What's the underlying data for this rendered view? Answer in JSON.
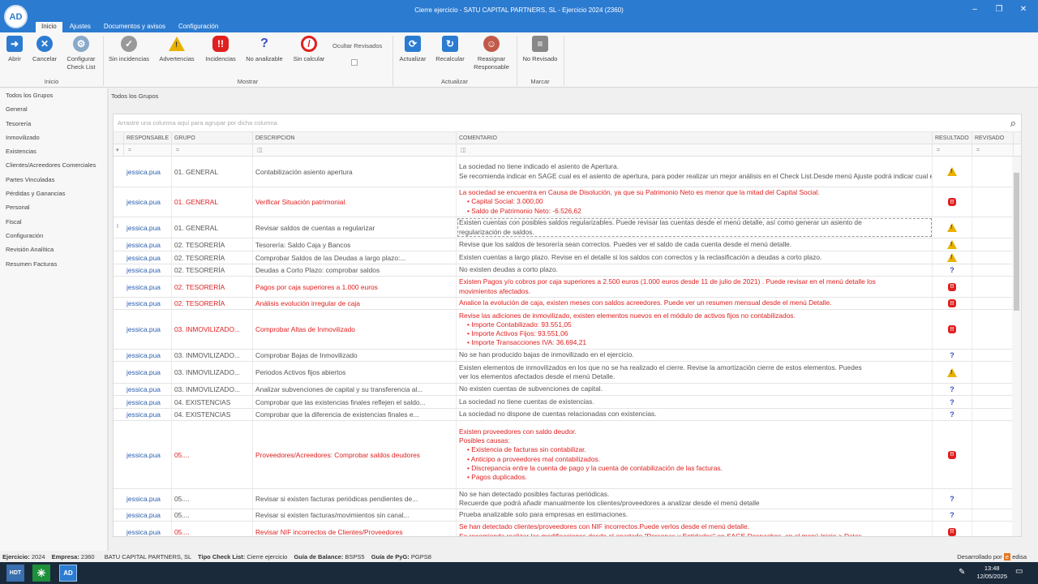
{
  "window": {
    "title": "Cierre ejercicio - SATU CAPITAL PARTNERS, SL - Ejercicio 2024 (2360)",
    "logo": "AD"
  },
  "tabs": [
    "Inicio",
    "Ajustes",
    "Documentos y avisos",
    "Configuración"
  ],
  "ribbon": {
    "abrir": "Abrir",
    "cancelar": "Cancelar",
    "configurar": "Configurar Check List",
    "sin_incidencias": "Sin incidencias",
    "advertencias": "Advertencias",
    "incidencias": "Incidencias",
    "no_analizable": "No analizable",
    "sin_calcular": "Sin calcular",
    "ocultar": "Ocultar Revisados",
    "actualizar": "Actualizar",
    "recalcular": "Recalcular",
    "reasignar": "Reasignar Responsable",
    "no_revisado": "No Revisado",
    "group_inicio": "Inicio",
    "group_mostrar": "Mostrar",
    "group_actualizar": "Actualizar",
    "group_marcar": "Marcar"
  },
  "sidebar": [
    "Todos los Grupos",
    "General",
    "Tesorería",
    "Inmovilizado",
    "Existencias",
    "Clientes/Acreedores Comerciales",
    "Partes Vinculadas",
    "Pérdidas y Ganancias",
    "Personal",
    "Fiscal",
    "Configuración",
    "Revisión Analítica",
    "Resumen Facturas"
  ],
  "breadcrumb": "Todos los Grupos",
  "grid": {
    "group_hint": "Arrastre una columna aquí para agrupar por dicha columna",
    "headers": {
      "responsable": "RESPONSABLE",
      "grupo": "GRUPO",
      "descripcion": "DESCRIPCION",
      "comentario": "COMENTARIO",
      "resultado": "RESULTADO",
      "revisado": "REVISADO"
    },
    "rows": [
      {
        "h": 38,
        "red": false,
        "resp": "jessica.pua",
        "grp": "01. GENERAL",
        "des": "Contabilización asiento apertura",
        "res": "warn",
        "com": [
          "La sociedad no tiene indicado el asiento de Apertura.",
          "Se recomienda indicar en SAGE cual es el asiento de apertura, para poder realizar un mejor análisis en el Check List.Desde menú Ajuste podrá indicar cual es el asiento de apertura."
        ]
      },
      {
        "h": 37,
        "red": true,
        "resp": "jessica.pua",
        "grp": "01. GENERAL",
        "des": "Verificar Situación patrimonial.",
        "res": "err",
        "com": [
          "La sociedad se encuentra en Causa de Disolución, ya que su Patrimonio Neto es menor que la mitad del Capital Social.",
          "• Capital Social: 3.000,00",
          "• Saldo de Patrimonio Neto: -6.526,62"
        ]
      },
      {
        "h": 26,
        "red": false,
        "sel": true,
        "ind": "I",
        "resp": "jessica.pua",
        "grp": "01. GENERAL",
        "des": "Revisar saldos de cuentas a regularizar",
        "res": "warn",
        "com": [
          "Existen cuentas con posibles saldos regularizables. Puede revisar las cuentas desde el menú detalle, así como generar un asiento de",
          "regularización de saldos."
        ]
      },
      {
        "h": 16,
        "red": false,
        "resp": "jessica.pua",
        "grp": "02. TESORERÍA",
        "des": "Tesorería: Saldo Caja y Bancos",
        "res": "warn",
        "com": [
          "Revise que los saldos de tesorería sean correctos. Puedes ver el saldo de cada cuenta desde el menú detalle."
        ]
      },
      {
        "h": 16,
        "red": false,
        "resp": "jessica.pua",
        "grp": "02. TESORERÍA",
        "des": "Comprobar Saldos de las Deudas a largo plazo:...",
        "res": "warn",
        "com": [
          "Existen cuentas a largo plazo. Revise en el detalle si los saldos con correctos y la reclasificación a deudas a corto plazo."
        ]
      },
      {
        "h": 15,
        "red": false,
        "resp": "jessica.pua",
        "grp": "02. TESORERÍA",
        "des": "Deudas a Corto Plazo: comprobar saldos",
        "res": "q",
        "com": [
          "No existen deudas a corto plazo."
        ]
      },
      {
        "h": 26,
        "red": true,
        "resp": "jessica.pua",
        "grp": "02. TESORERÍA",
        "des": "Pagos por caja superiores a 1.000 euros",
        "res": "err",
        "com": [
          "Existen Pagos y/o cobros por caja superiores a 2.500 euros (1.000 euros desde 11 de julio de 2021) . Puede revisar en el menú detalle los",
          "movimientos afectados."
        ]
      },
      {
        "h": 15,
        "red": true,
        "resp": "jessica.pua",
        "grp": "02. TESORERÍA",
        "des": "Análisis evolución irregular de caja",
        "res": "err",
        "com": [
          "Analice la evolución de caja, existen meses con saldos acreedores. Puede ver un resumen mensual desde el menú Detalle."
        ]
      },
      {
        "h": 49,
        "red": true,
        "resp": "jessica.pua",
        "grp": "03. INMOVILIZADO...",
        "des": "Comprobar Altas de Inmovilizado",
        "res": "err",
        "com": [
          "Revise las adiciones de inmovilizado, existen elementos nuevos en el módulo de activos fijos no contabilizados.",
          "• Importe Contabilizado: 93.551,05",
          "• Importe Activos Fijos: 93.551,06",
          "• Importe Transacciones IVA: 36.694,21"
        ]
      },
      {
        "h": 15,
        "red": false,
        "resp": "jessica.pua",
        "grp": "03. INMOVILIZADO...",
        "des": "Comprobar Bajas de Inmovilizado",
        "res": "q",
        "com": [
          "No se han producido bajas de inmovilizado en el ejercicio."
        ]
      },
      {
        "h": 27,
        "red": false,
        "resp": "jessica.pua",
        "grp": "03. INMOVILIZADO...",
        "des": "Periodos Activos fijos abiertos",
        "res": "warn",
        "com": [
          "Existen elementos de inmovilizados en los que no se ha realizado el cierre. Revise la amortización cierre de estos elementos. Puedes",
          "ver los elementos afectados desde el menú Detalle."
        ]
      },
      {
        "h": 15,
        "red": false,
        "resp": "jessica.pua",
        "grp": "03. INMOVILIZADO...",
        "des": "Analizar subvenciones de capital y su transferencia al...",
        "res": "q",
        "com": [
          "No existen cuentas de subvenciones de capital."
        ]
      },
      {
        "h": 16,
        "red": false,
        "resp": "jessica.pua",
        "grp": "04. EXISTENCIAS",
        "des": "Comprobar que las existencias finales reflejen el saldo...",
        "res": "q",
        "com": [
          "La sociedad no tiene cuentas de existencias."
        ]
      },
      {
        "h": 15,
        "red": false,
        "resp": "jessica.pua",
        "grp": "04. EXISTENCIAS",
        "des": "Comprobar que la diferencia de existencias finales e...",
        "res": "q",
        "com": [
          "La sociedad no dispone de cuentas relacionadas con existencias."
        ]
      },
      {
        "h": 84,
        "red": true,
        "resp": "jessica.pua",
        "grp": "05....",
        "des": "Proveedores/Acreedores: Comprobar saldos deudores",
        "res": "err",
        "com": [
          "Existen proveedores con saldo deudor.",
          "Posibles causas:",
          "• Existencia de facturas sin contabilizar.",
          "• Anticipo a proveedores mal contabilizados.",
          "• Discrepancia entre la cuenta de pago y la cuenta de contabilización de las facturas.",
          "• Pagos duplicados."
        ]
      },
      {
        "h": 25,
        "red": false,
        "resp": "jessica.pua",
        "grp": "05....",
        "des": "Revisar si existen facturas periódicas pendientes de...",
        "res": "q",
        "com": [
          "No se han detectado posibles facturas periódicas.",
          "Recuerde que podrá añadir manualmente los clientes/proveedores a analizar desde el menú detalle"
        ]
      },
      {
        "h": 15,
        "red": false,
        "resp": "jessica.pua",
        "grp": "05....",
        "des": "Revisar si existen facturas/movimientos sin canal...",
        "res": "q",
        "com": [
          "Prueba analizable solo para empresas en estimaciones."
        ]
      },
      {
        "h": 26,
        "red": true,
        "resp": "jessica.pua",
        "grp": "05....",
        "des": "Revisar NIF incorrectos de Clientes/Proveedores",
        "res": "err",
        "com": [
          "Se han detectado clientes/proveedores con NIF incorrectos.Puede verlos desde el menú detalle.",
          "Se recomienda realizar las modificaciones desde el apartado \"Personas y Entidades\" en SAGE Despachos, en el menú Inicio > Datos"
        ]
      }
    ]
  },
  "status": {
    "ejercicio_label": "Ejercicio:",
    "ejercicio": "2024",
    "empresa_label": "Empresa:",
    "empresa": "2360",
    "empresa_name": "BATU CAPITAL PARTNERS, SL",
    "tipo_label": "Tipo Check List:",
    "tipo": "Cierre ejercicio",
    "balance_label": "Guía de Balance:",
    "balance": "BSPS5",
    "pyg_label": "Guía de PyG:",
    "pyg": "PGPS8",
    "dev": "Desarrollado por",
    "dev_brand": "edisa"
  },
  "taskbar": {
    "time": "13:48",
    "date": "12/05/2025",
    "app1": "HDT"
  },
  "colors": {
    "accent": "#2b7bd1",
    "error": "#e02020",
    "warning": "#e8b100",
    "question": "#3b4cc0"
  }
}
